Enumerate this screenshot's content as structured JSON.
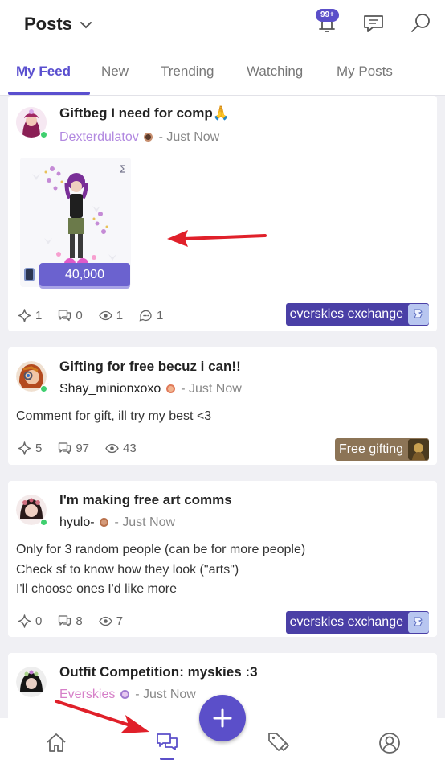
{
  "header": {
    "title": "Posts",
    "badge": "99+"
  },
  "tabs": [
    {
      "label": "My Feed"
    },
    {
      "label": "New"
    },
    {
      "label": "Trending"
    },
    {
      "label": "Watching"
    },
    {
      "label": "My Posts"
    }
  ],
  "posts": [
    {
      "title": "Giftbeg I need for comp🙏",
      "author": "Dexterdulatov",
      "time": "- Just Now",
      "price": "40,000",
      "stats": {
        "stars": "1",
        "replies": "0",
        "views": "1",
        "comments": "1"
      },
      "tag": "everskies exchange"
    },
    {
      "title": "Gifting for free becuz i can!!",
      "author": "Shay_minionxoxo",
      "time": "- Just Now",
      "body": [
        "Comment for gift, ill try my best <3"
      ],
      "stats": {
        "stars": "5",
        "replies": "97",
        "views": "43"
      },
      "tag": "Free gifting"
    },
    {
      "title": "I'm making free art comms",
      "author": "hyulo-",
      "time": "- Just Now",
      "body": [
        "Only for 3 random people (can be for more people)",
        "Check sf to know how they look (\"arts\")",
        "I'll choose ones I'd like more"
      ],
      "stats": {
        "stars": "0",
        "replies": "8",
        "views": "7"
      },
      "tag": "everskies exchange"
    },
    {
      "title": "Outfit Competition: myskies :3",
      "author": "Everskies",
      "time": "- Just Now"
    }
  ],
  "colors": {
    "accent": "#5b4fc9",
    "tag_exchange": "#4a3fa6",
    "tag_gifting": "#8c7456",
    "online": "#3fcf6f",
    "annotation": "#e0202a"
  }
}
